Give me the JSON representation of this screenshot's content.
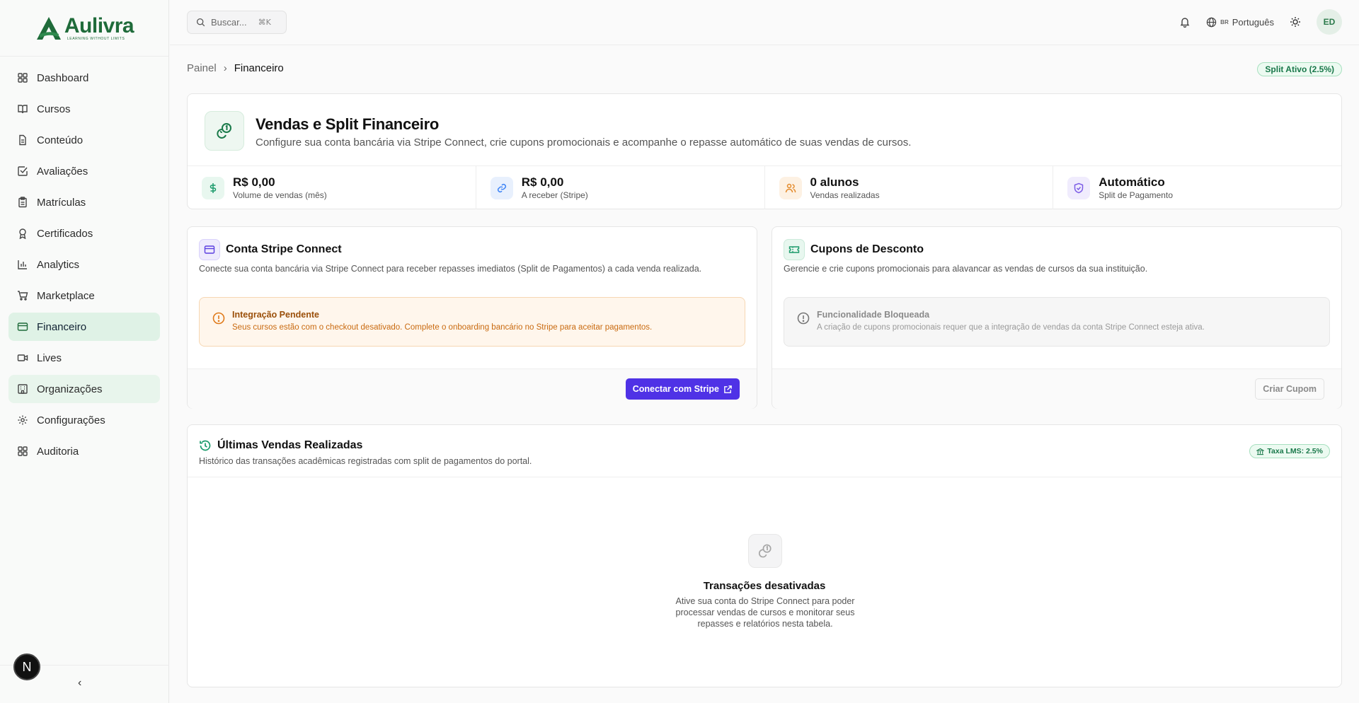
{
  "brand": {
    "name": "Aulivra",
    "tagline": "LEARNING WITHOUT LIMITS",
    "green": "#1f6b3a",
    "accent": "#4f32e6"
  },
  "sidebar": {
    "items": [
      {
        "label": "Dashboard",
        "icon": "dashboard-icon"
      },
      {
        "label": "Cursos",
        "icon": "book-icon"
      },
      {
        "label": "Conteúdo",
        "icon": "file-icon"
      },
      {
        "label": "Avaliações",
        "icon": "check-square-icon"
      },
      {
        "label": "Matrículas",
        "icon": "clipboard-icon"
      },
      {
        "label": "Certificados",
        "icon": "award-icon"
      },
      {
        "label": "Analytics",
        "icon": "bar-chart-icon"
      },
      {
        "label": "Marketplace",
        "icon": "cart-icon"
      },
      {
        "label": "Financeiro",
        "icon": "credit-card-icon"
      },
      {
        "label": "Lives",
        "icon": "video-icon"
      },
      {
        "label": "Organizações",
        "icon": "building-icon"
      },
      {
        "label": "Configurações",
        "icon": "gear-icon"
      },
      {
        "label": "Auditoria",
        "icon": "grid-icon"
      }
    ],
    "active": "Financeiro",
    "badge": "N",
    "collapse": "‹"
  },
  "topbar": {
    "search_placeholder": "Buscar...",
    "shortcut": "⌘K",
    "lang_code": "BR",
    "lang": "Português",
    "avatar": "ED"
  },
  "breadcrumb": {
    "root": "Painel",
    "current": "Financeiro"
  },
  "split_badge": "Split Ativo (2.5%)",
  "hero": {
    "title": "Vendas e Split Financeiro",
    "subtitle": "Configure sua conta bancária via Stripe Connect, crie cupons promocionais e acompanhe o repasse automático de suas vendas de cursos.",
    "stats": [
      {
        "value": "R$ 0,00",
        "label": "Volume de vendas (mês)",
        "icon": "dollar-icon",
        "color": "#1a9a6a",
        "bg": "#e8f7ef"
      },
      {
        "value": "R$ 0,00",
        "label": "A receber (Stripe)",
        "icon": "link-icon",
        "color": "#3b82f6",
        "bg": "#e8f0fd"
      },
      {
        "value": "0 alunos",
        "label": "Vendas realizadas",
        "icon": "users-icon",
        "color": "#e48a2b",
        "bg": "#fdf1e3"
      },
      {
        "value": "Automático",
        "label": "Split de Pagamento",
        "icon": "shield-check-icon",
        "color": "#7c5ce6",
        "bg": "#f0ecfd"
      }
    ]
  },
  "stripe": {
    "title": "Conta Stripe Connect",
    "subtitle": "Conecte sua conta bancária via Stripe Connect para receber repasses imediatos (Split de Pagamentos) a cada venda realizada.",
    "alert_title": "Integração Pendente",
    "alert_text": "Seus cursos estão com o checkout desativado. Complete o onboarding bancário no Stripe para aceitar pagamentos.",
    "button": "Conectar com Stripe"
  },
  "coupons": {
    "title": "Cupons de Desconto",
    "subtitle": "Gerencie e crie cupons promocionais para alavancar as vendas de cursos da sua instituição.",
    "alert_title": "Funcionalidade Bloqueada",
    "alert_text": "A criação de cupons promocionais requer que a integração de vendas da conta Stripe Connect esteja ativa.",
    "button": "Criar Cupom"
  },
  "sales": {
    "title": "Últimas Vendas Realizadas",
    "subtitle": "Histórico das transações acadêmicas registradas com split de pagamentos do portal.",
    "tax_badge": "Taxa LMS: 2.5%",
    "empty_title": "Transações desativadas",
    "empty_text": "Ative sua conta do Stripe Connect para poder processar vendas de cursos e monitorar seus repasses e relatórios nesta tabela."
  }
}
